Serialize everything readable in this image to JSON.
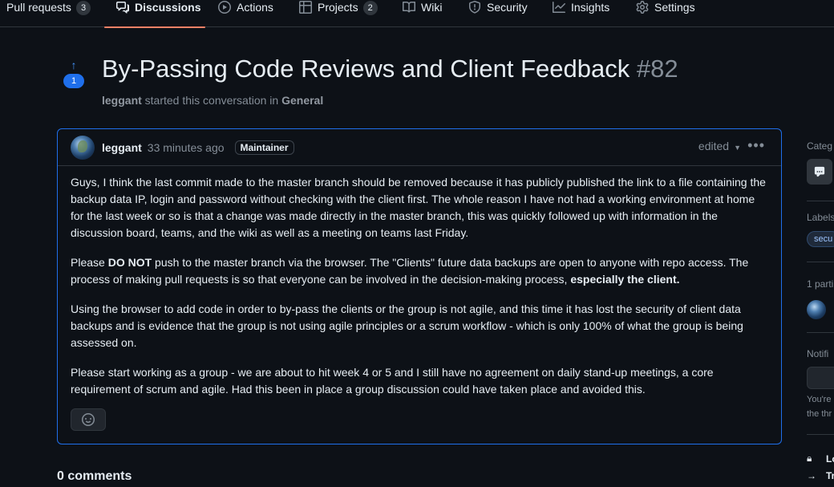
{
  "tabs": [
    {
      "label": "Pull requests",
      "count": "3",
      "icon": "pull-request-icon"
    },
    {
      "label": "Discussions",
      "count": null,
      "icon": "comment-discussion-icon",
      "active": true
    },
    {
      "label": "Actions",
      "count": null,
      "icon": "play-icon"
    },
    {
      "label": "Projects",
      "count": "2",
      "icon": "table-icon"
    },
    {
      "label": "Wiki",
      "count": null,
      "icon": "book-icon"
    },
    {
      "label": "Security",
      "count": null,
      "icon": "shield-icon"
    },
    {
      "label": "Insights",
      "count": null,
      "icon": "graph-icon"
    },
    {
      "label": "Settings",
      "count": null,
      "icon": "gear-icon"
    }
  ],
  "discussion": {
    "upvotes": "1",
    "title": "By-Passing Code Reviews and Client Feedback",
    "number": "#82",
    "author": "leggant",
    "meta_middle": "started this conversation in",
    "category": "General"
  },
  "post": {
    "author": "leggant",
    "time": "33 minutes ago",
    "role_badge": "Maintainer",
    "edited_label": "edited",
    "p1": "Guys, I think the last commit made to the master branch should be removed because it has publicly published the link to a file containing the backup data IP, login and password without checking with the client first. The whole reason I have not had a working environment at home for the last week or so is that a change was made directly in the master branch, this was quickly followed up with information in the discussion board, teams, and the wiki as well as a meeting on teams last Friday.",
    "p2_a": "Please ",
    "p2_b": "DO NOT",
    "p2_c": " push to the master branch via the browser. The \"Clients\" future data backups are open to anyone with repo access. The process of making pull requests is so that everyone can be involved in the decision-making process, ",
    "p2_d": "especially the client.",
    "p3": "Using the browser to add code in order to by-pass the clients or the group is not agile, and this time it has lost the security of client data backups and is evidence that the group is not using agile principles or a scrum workflow - which is only 100% of what the group is being assessed on.",
    "p4": "Please start working as a group - we are about to hit week 4 or 5 and I still have no agreement on daily stand-up meetings, a core requirement of scrum and agile. Had this been in place a group discussion could have taken place and avoided this."
  },
  "comments_heading": "0 comments",
  "sidebar": {
    "category_label": "Categ",
    "labels_label": "Labels",
    "label_pill": "secu",
    "participants_label": "1 parti",
    "notifications_label": "Notifi",
    "notif_text_1": "You're",
    "notif_text_2": "the thr",
    "lock_label": "Lo",
    "transfer_label": "Tr"
  }
}
